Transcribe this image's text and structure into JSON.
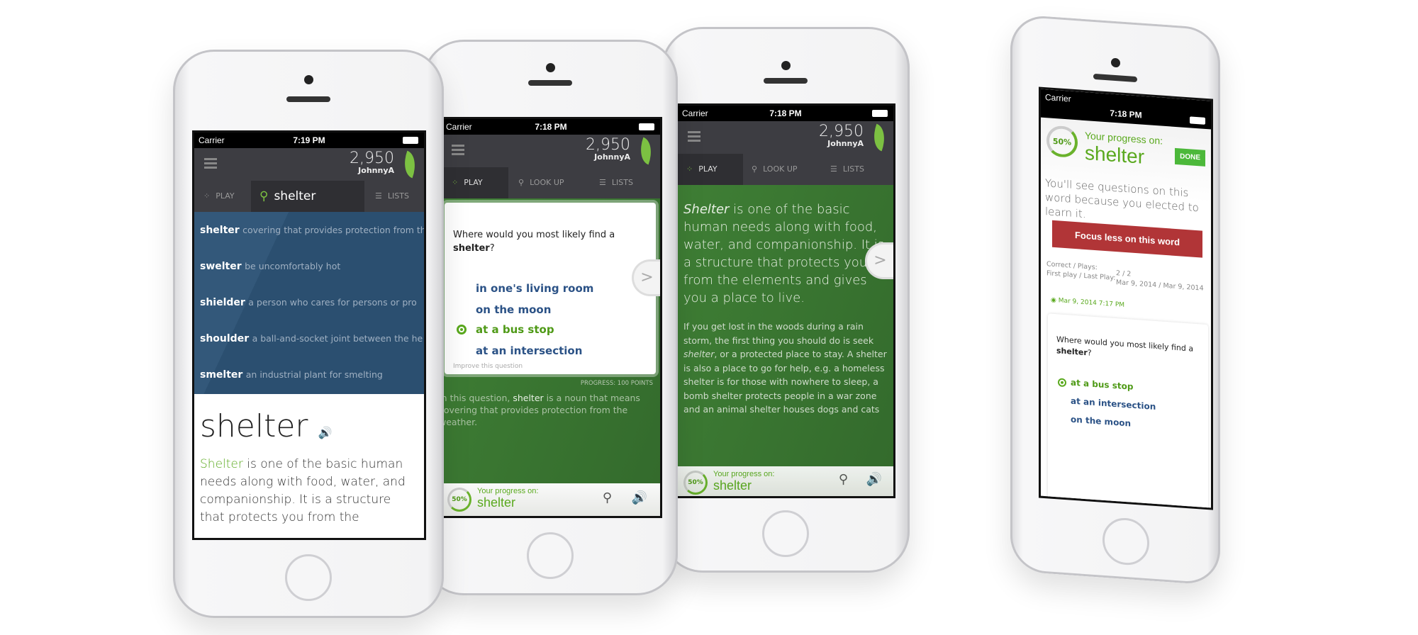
{
  "common": {
    "carrier": "Carrier",
    "score": "2,950",
    "user": "JohnnyA",
    "tab_play": "PLAY",
    "tab_lookup": "LOOK UP",
    "tab_lists": "LISTS",
    "progress_label": "Your progress on:",
    "word": "shelter",
    "percent": "50%",
    "progress_value": 0.5,
    "next": ">",
    "accent": "#7cc142",
    "list_bg": "#2d4f6e",
    "green_bg": "#3c7a32"
  },
  "phone1": {
    "time": "7:19 PM",
    "search_value": "shelter",
    "results": [
      {
        "word": "shelter",
        "def": "covering that provides protection from the"
      },
      {
        "word": "swelter",
        "def": "be uncomfortably hot"
      },
      {
        "word": "shielder",
        "def": "a person who cares for persons or pro"
      },
      {
        "word": "shoulder",
        "def": "a ball-and-socket joint between the he"
      },
      {
        "word": "smelter",
        "def": "an industrial plant for smelting"
      }
    ],
    "headword": "shelter",
    "def_word": "Shelter",
    "def_rest": " is one of the basic human needs along with food, water, and companionship. It is a structure that protects you from the"
  },
  "phone2": {
    "time": "7:18 PM",
    "question_pre": "Where would you most likely find a ",
    "question_word": "shelter",
    "question_post": "?",
    "options": [
      "in one's living room",
      "on the moon",
      "at a bus stop",
      "at an intersection"
    ],
    "improve": "Improve this question",
    "progress_points": "PROGRESS: 100 POINTS",
    "explain_pre": "In this question, ",
    "explain_word": "shelter",
    "explain_post": " is a noun that means covering that provides protection from the weather."
  },
  "phone3": {
    "time": "7:18 PM",
    "lead_word": "Shelter",
    "lead_rest": " is one of the basic human needs along with food, water, and companionship. It is a structure that protects you from the elements and gives you a place to live.",
    "body_pre": "If you get lost in the woods during a rain storm, the first thing you should do is seek ",
    "body_word": "shelter",
    "body_post": ", or a protected place to stay. A shelter is also a place to go for help, e.g. a homeless shelter is for those with nowhere to sleep, a bomb shelter protects people in a war zone and an animal shelter houses dogs and cats"
  },
  "phone4": {
    "time": "7:18 PM",
    "done": "DONE",
    "note": "You'll see questions on this word because you elected to learn it.",
    "focus_button": "Focus less on this word",
    "stats": [
      {
        "label": "Correct / Plays:",
        "value": "2 / 2"
      },
      {
        "label": "First play / Last Play:",
        "value": "Mar 9, 2014 / Mar 9, 2014"
      }
    ],
    "history_date": "Mar 9, 2014 7:17 PM",
    "options": [
      "at a bus stop",
      "at an intersection",
      "on the moon"
    ]
  }
}
